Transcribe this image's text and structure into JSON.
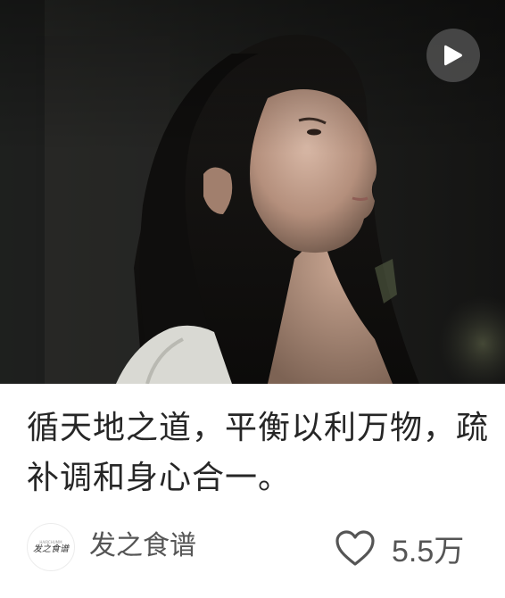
{
  "post": {
    "title": "循天地之道，平衡以利万物，疏补调和身心合一。",
    "cover_icon": "play-icon"
  },
  "author": {
    "name": "发之食谱",
    "avatar_small_text": "HAIRCHUMM",
    "avatar_logo_text": "发之食谱"
  },
  "stats": {
    "likes": "5.5万",
    "like_icon": "heart-outline-icon"
  },
  "colors": {
    "title_text": "#262626",
    "meta_text": "#555555",
    "play_button_bg": "#5a5a5a"
  }
}
